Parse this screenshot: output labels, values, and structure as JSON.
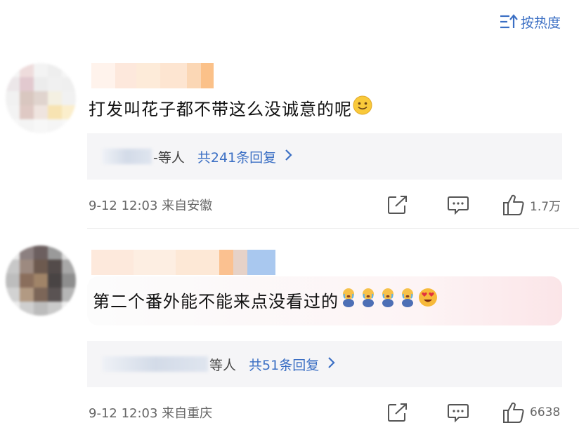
{
  "sort": {
    "label": "按热度",
    "icon": "sort-icon"
  },
  "comments": [
    {
      "text": "打发叫花子都不带这么没诚意的呢",
      "emojis": [
        "slight-smile-emoji"
      ],
      "reply_deng": "-等人",
      "reply_count": "共241条回复",
      "time_location": "9-12 12:03  来自安徽",
      "likes": "1.7万"
    },
    {
      "text": "第二个番外能不能来点没看过的",
      "emojis": [
        "crying-emoji",
        "crying-emoji",
        "crying-emoji",
        "crying-emoji",
        "heart-eyes-emoji"
      ],
      "reply_deng": "等人",
      "reply_count": "共51条回复",
      "time_location": "9-12 12:03  来自重庆",
      "likes": "6638"
    }
  ],
  "colors": {
    "accent": "#3b6fc4",
    "reply_bg": "#f5f5f7",
    "meta_text": "#666666"
  }
}
